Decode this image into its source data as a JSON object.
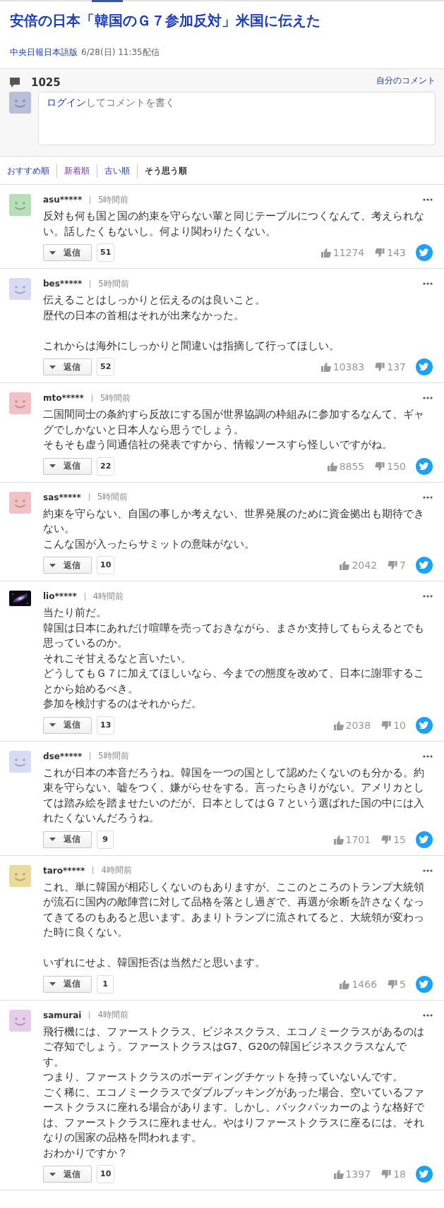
{
  "article": {
    "title": "安倍の日本「韓国のＧ７参加反対」米国に伝えた",
    "source": "中央日報日本語版",
    "date": "6/28(日) 11:35配信"
  },
  "comment_header": {
    "count": "1025",
    "my_comments_link": "自分のコメント",
    "prompt_link": "ログイン",
    "prompt_text": "してコメントを書く"
  },
  "sort_tabs": [
    {
      "label": "おすすめ順",
      "selected": false,
      "visited": false
    },
    {
      "label": "新着順",
      "selected": false,
      "visited": true
    },
    {
      "label": "古い順",
      "selected": false,
      "visited": false
    },
    {
      "label": "そう思う順",
      "selected": true,
      "visited": false
    }
  ],
  "comments": [
    {
      "user": "asu*****",
      "time": "5時間前",
      "avatar": {
        "kind": "face",
        "color": "#b7e0b7"
      },
      "paragraphs": [
        [
          "反対も何も国と国の約束を守らない輩と同じテーブルにつくなんて、考えられない。話したくもないし。何より関わりたくない。"
        ]
      ],
      "reply_label": "返信",
      "replies": "51",
      "likes": "11274",
      "dislikes": "143"
    },
    {
      "user": "bes*****",
      "time": "5時間前",
      "avatar": {
        "kind": "face",
        "color": "#d9dbf4"
      },
      "paragraphs": [
        [
          "伝えることはしっかりと伝えるのは良いこと。",
          "歴代の日本の首相はそれが出来なかった。"
        ],
        [
          "これからは海外にしっかりと間違いは指摘して行ってほしい。"
        ]
      ],
      "reply_label": "返信",
      "replies": "52",
      "likes": "10383",
      "dislikes": "137"
    },
    {
      "user": "mto*****",
      "time": "5時間前",
      "avatar": {
        "kind": "face",
        "color": "#f3c0c6"
      },
      "paragraphs": [
        [
          "二国間同士の条約すら反故にする国が世界協調の枠組みに参加するなんて、ギャグでしかないと日本人なら思うでしょう。",
          "そもそも虚う同通信社の発表ですから、情報ソースすら怪しいですがね。"
        ]
      ],
      "reply_label": "返信",
      "replies": "22",
      "likes": "8855",
      "dislikes": "150"
    },
    {
      "user": "sas*****",
      "time": "5時間前",
      "avatar": {
        "kind": "face",
        "color": "#f3c0c6"
      },
      "paragraphs": [
        [
          "約束を守らない、自国の事しか考えない、世界発展のために資金拠出も期待できない。",
          "こんな国が入ったらサミットの意味がない。"
        ]
      ],
      "reply_label": "返信",
      "replies": "10",
      "likes": "2042",
      "dislikes": "7"
    },
    {
      "user": "lio*****",
      "time": "4時間前",
      "avatar": {
        "kind": "picture"
      },
      "paragraphs": [
        [
          "当たり前だ。",
          "韓国は日本にあれだけ喧嘩を売っておきながら、まさか支持してもらえるとでも思っているのか。",
          "それこそ甘えるなと言いたい。",
          "どうしてもＧ７に加えてほしいなら、今までの態度を改めて、日本に謝罪することから始めるべき。",
          "参加を検討するのはそれからだ。"
        ]
      ],
      "reply_label": "返信",
      "replies": "13",
      "likes": "2038",
      "dislikes": "10"
    },
    {
      "user": "dse*****",
      "time": "5時間前",
      "avatar": {
        "kind": "face",
        "color": "#d9dbf4"
      },
      "paragraphs": [
        [
          "これが日本の本音だろうね。韓国を一つの国として認めたくないのも分かる。約束を守らない、嘘をつく、嫌がらせをする。言ったらきりがない。アメリカとしては踏み絵を踏ませたいのだが、日本としてはＧ７という選ばれた国の中には入れたくないんだろうね。"
        ]
      ],
      "reply_label": "返信",
      "replies": "9",
      "likes": "1701",
      "dislikes": "15"
    },
    {
      "user": "taro*****",
      "time": "4時間前",
      "avatar": {
        "kind": "face",
        "color": "#eadb9c"
      },
      "paragraphs": [
        [
          "これ、単に韓国が相応しくないのもありますが、ここのところのトランプ大統領が流石に国内の敵陣営に対して品格を落とし過ぎで、再選が余断を許さなくなってきてるのもあると思います。あまりトランプに流されてると、大統領が変わった時に良くない。"
        ],
        [
          "いずれにせよ、韓国拒否は当然だと思います。"
        ]
      ],
      "reply_label": "返信",
      "replies": "1",
      "likes": "1466",
      "dislikes": "5"
    },
    {
      "user": "samurai",
      "time": "4時間前",
      "avatar": {
        "kind": "face",
        "color": "#e6cdea"
      },
      "paragraphs": [
        [
          "飛行機には、ファーストクラス、ビジネスクラス、エコノミークラスがあるのはご存知でしょう。ファーストクラスはG7、G20の韓国ビジネスクラスなんです。",
          "つまり、ファーストクラスのボーディングチケットを持っていないんです。",
          "ごく稀に、エコノミークラスでダブルブッキングがあった場合、空いているファーストクラスに座れる場合があります。しかし、バックパッカーのような格好では、ファーストクラスに座れません。やはりファーストクラスに座るには、それなりの国家の品格を問われます。",
          "おわかりですか？"
        ]
      ],
      "reply_label": "返信",
      "replies": "10",
      "likes": "1397",
      "dislikes": "18"
    }
  ]
}
